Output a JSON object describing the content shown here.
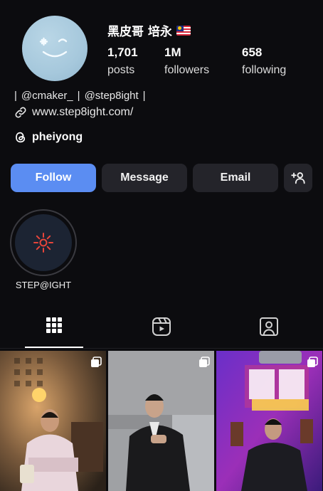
{
  "profile": {
    "display_name": "黑皮哥 培永",
    "stats": [
      {
        "value": "1,701",
        "label": "posts"
      },
      {
        "value": "1M",
        "label": "followers"
      },
      {
        "value": "658",
        "label": "following"
      }
    ],
    "bio_mentions": [
      "@cmaker_",
      "@step8ight"
    ],
    "bio_separator": "|",
    "link": "www.step8ight.com/",
    "threads_handle": "pheiyong"
  },
  "actions": {
    "follow": "Follow",
    "message": "Message",
    "email": "Email"
  },
  "highlights": [
    {
      "label": "STEP@IGHT"
    }
  ],
  "tabs": [
    "grid-icon",
    "reels-icon",
    "tagged-icon"
  ],
  "colors": {
    "follow_button": "#5b8df2",
    "secondary_button": "#24242a",
    "background": "#0c0c0f"
  },
  "grid_posts": [
    {
      "description": "man in pink hoodie seated in a warm-lit room",
      "multi": true
    },
    {
      "description": "man in black suit seated on a grey sofa",
      "multi": true
    },
    {
      "description": "man in black outfit on purple awards stage",
      "multi": true
    }
  ]
}
